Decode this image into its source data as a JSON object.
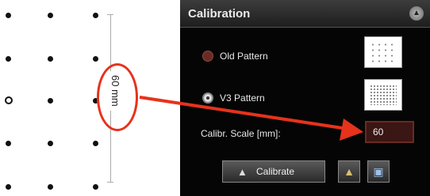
{
  "ruler": {
    "label": "60 mm"
  },
  "panel": {
    "title": "Calibration",
    "options": [
      {
        "label": "Old Pattern",
        "selected": false
      },
      {
        "label": "V3 Pattern",
        "selected": true
      }
    ],
    "scale_label": "Calibr. Scale [mm]:",
    "scale_value": "60",
    "calibrate_label": "Calibrate",
    "icons": [
      "collapse-icon",
      "calibrate-icon",
      "export-icon",
      "save-icon"
    ]
  },
  "colors": {
    "highlight": "#e7321c",
    "panel_bg": "#050505",
    "input_bg": "#3a1614"
  }
}
